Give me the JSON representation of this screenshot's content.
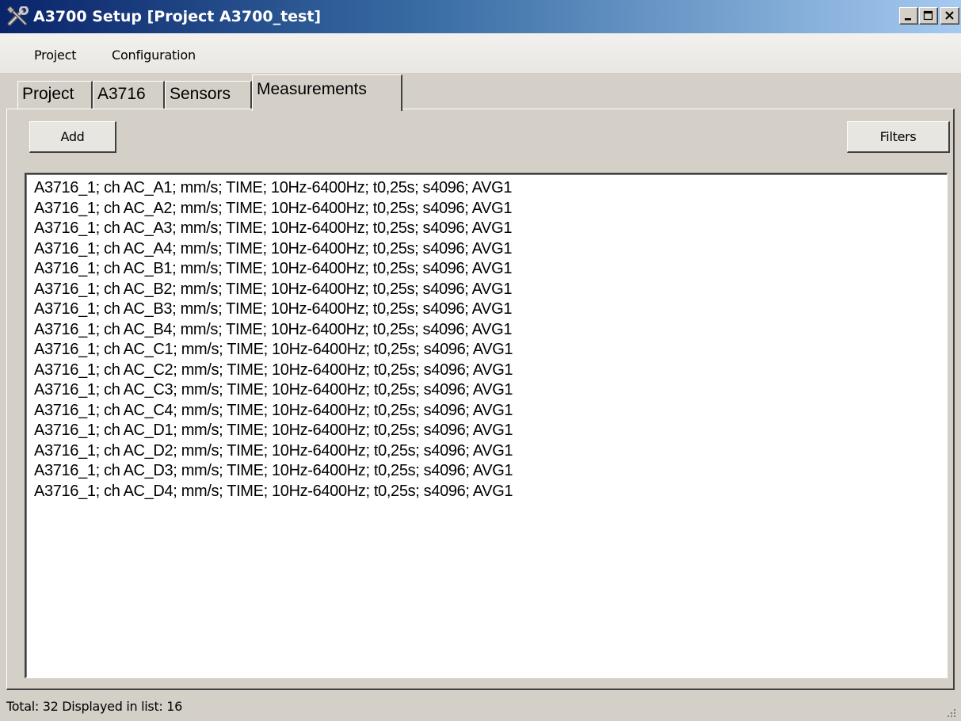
{
  "window": {
    "title": "A3700 Setup [Project A3700_test]",
    "icon": "tools-icon",
    "controls": [
      "minimize-icon",
      "maximize-icon",
      "close-icon"
    ]
  },
  "menu": {
    "items": [
      {
        "label": "Project"
      },
      {
        "label": "Configuration"
      }
    ]
  },
  "tabs": [
    {
      "label": "Project",
      "active": false
    },
    {
      "label": "A3716",
      "active": false
    },
    {
      "label": "Sensors",
      "active": false
    },
    {
      "label": "Measurements",
      "active": true
    }
  ],
  "toolbar": {
    "add_label": "Add",
    "filters_label": "Filters"
  },
  "measurements": [
    "A3716_1; ch AC_A1; mm/s; TIME; 10Hz-6400Hz; t0,25s; s4096; AVG1",
    "A3716_1; ch AC_A2; mm/s; TIME; 10Hz-6400Hz; t0,25s; s4096; AVG1",
    "A3716_1; ch AC_A3; mm/s; TIME; 10Hz-6400Hz; t0,25s; s4096; AVG1",
    "A3716_1; ch AC_A4; mm/s; TIME; 10Hz-6400Hz; t0,25s; s4096; AVG1",
    "A3716_1; ch AC_B1; mm/s; TIME; 10Hz-6400Hz; t0,25s; s4096; AVG1",
    "A3716_1; ch AC_B2; mm/s; TIME; 10Hz-6400Hz; t0,25s; s4096; AVG1",
    "A3716_1; ch AC_B3; mm/s; TIME; 10Hz-6400Hz; t0,25s; s4096; AVG1",
    "A3716_1; ch AC_B4; mm/s; TIME; 10Hz-6400Hz; t0,25s; s4096; AVG1",
    "A3716_1; ch AC_C1; mm/s; TIME; 10Hz-6400Hz; t0,25s; s4096; AVG1",
    "A3716_1; ch AC_C2; mm/s; TIME; 10Hz-6400Hz; t0,25s; s4096; AVG1",
    "A3716_1; ch AC_C3; mm/s; TIME; 10Hz-6400Hz; t0,25s; s4096; AVG1",
    "A3716_1; ch AC_C4; mm/s; TIME; 10Hz-6400Hz; t0,25s; s4096; AVG1",
    "A3716_1; ch AC_D1; mm/s; TIME; 10Hz-6400Hz; t0,25s; s4096; AVG1",
    "A3716_1; ch AC_D2; mm/s; TIME; 10Hz-6400Hz; t0,25s; s4096; AVG1",
    "A3716_1; ch AC_D3; mm/s; TIME; 10Hz-6400Hz; t0,25s; s4096; AVG1",
    "A3716_1; ch AC_D4; mm/s; TIME; 10Hz-6400Hz; t0,25s; s4096; AVG1"
  ],
  "status": {
    "text": "Total: 32 Displayed in list: 16"
  },
  "colors": {
    "titlebar_start": "#0a246a",
    "titlebar_end": "#a6caf0",
    "face": "#d4d0c8",
    "list_bg": "#ffffff"
  }
}
